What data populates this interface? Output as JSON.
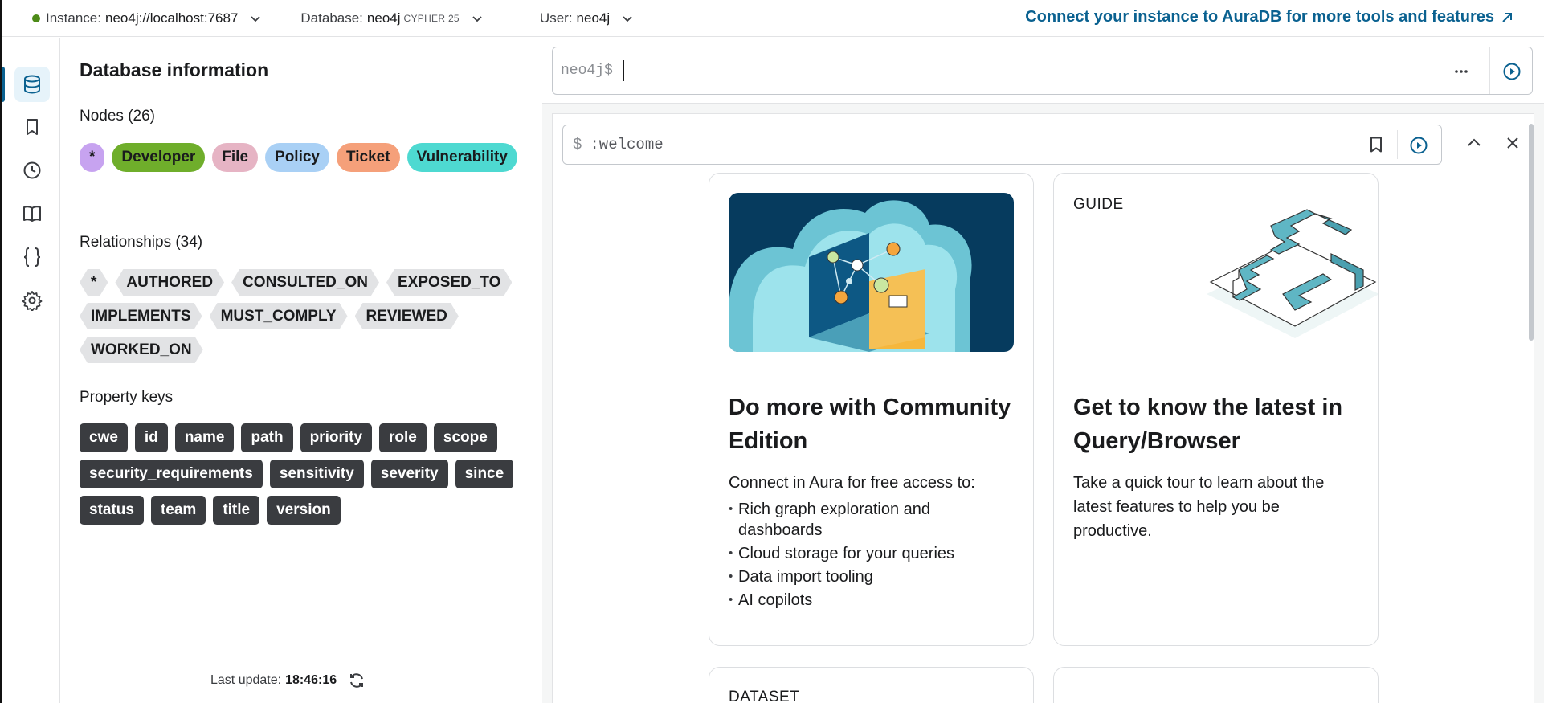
{
  "topbar": {
    "instance_label": "Instance:",
    "instance_value": "neo4j://localhost:7687",
    "database_label": "Database:",
    "database_value": "neo4j",
    "cypher_version": "CYPHER 25",
    "user_label": "User:",
    "user_value": "neo4j",
    "aura_link": "Connect your instance to AuraDB for more tools and features",
    "status_color": "#4d8b18"
  },
  "rail": {
    "items": [
      "database-icon",
      "bookmark-icon",
      "history-icon",
      "book-icon",
      "braces-icon",
      "gear-icon"
    ]
  },
  "dbinfo": {
    "title": "Database information",
    "nodes_title": "Nodes (26)",
    "nodes": [
      {
        "label": "*",
        "color": "#c7a3f0"
      },
      {
        "label": "Developer",
        "color": "#6fae2b"
      },
      {
        "label": "File",
        "color": "#e6b4c4"
      },
      {
        "label": "Policy",
        "color": "#a9d0f5"
      },
      {
        "label": "Ticket",
        "color": "#f5a07a"
      },
      {
        "label": "Vulnerability",
        "color": "#4ed9d1"
      }
    ],
    "rels_title": "Relationships (34)",
    "relationships": [
      "*",
      "AUTHORED",
      "CONSULTED_ON",
      "EXPOSED_TO",
      "IMPLEMENTS",
      "MUST_COMPLY",
      "REVIEWED",
      "WORKED_ON"
    ],
    "props_title": "Property keys",
    "property_keys": [
      "cwe",
      "id",
      "name",
      "path",
      "priority",
      "role",
      "scope",
      "security_requirements",
      "sensitivity",
      "severity",
      "since",
      "status",
      "team",
      "title",
      "version"
    ],
    "last_update_label": "Last update:",
    "last_update_time": "18:46:16"
  },
  "editor": {
    "prompt": "neo4j$"
  },
  "frame": {
    "prompt_symbol": "$",
    "command": ":welcome"
  },
  "cards": {
    "community": {
      "title": "Do more with Community Edition",
      "intro": "Connect in Aura for free access to:",
      "items": [
        "Rich graph exploration and dashboards",
        "Cloud storage for your queries",
        "Data import tooling",
        "AI copilots"
      ]
    },
    "guide": {
      "tag": "GUIDE",
      "title": "Get to know the latest in Query/Browser",
      "desc": "Take a quick tour to learn about the latest features to help you be productive."
    },
    "dataset": {
      "tag": "DATASET"
    }
  }
}
